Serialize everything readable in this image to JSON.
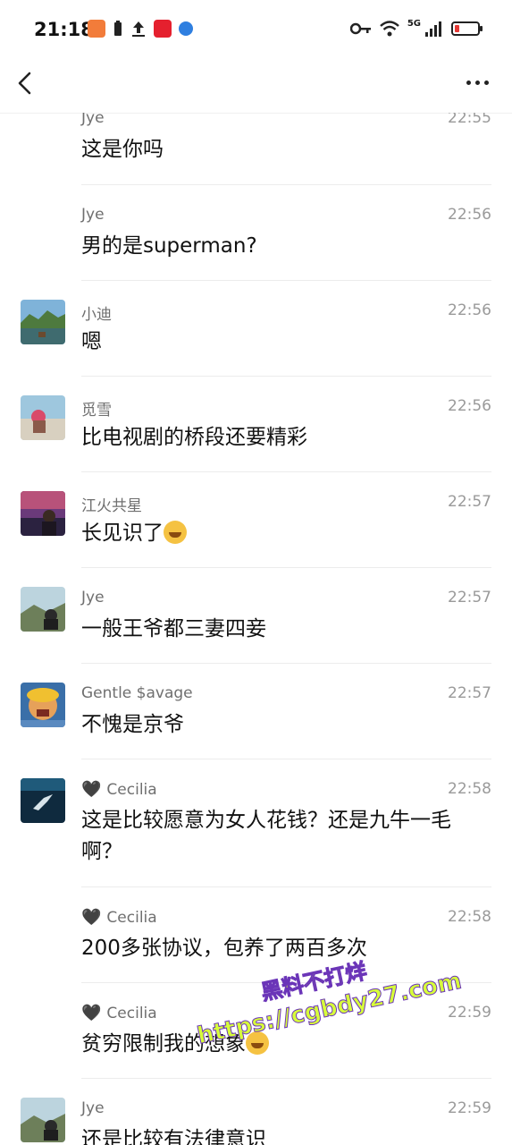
{
  "status_bar": {
    "time": "21:18",
    "network": "5G",
    "icons_left": [
      "shield-app-icon",
      "battery-saver-icon",
      "upload-icon",
      "app-red-icon",
      "app-blue-icon"
    ],
    "icons_right": [
      "key-icon",
      "wifi-icon",
      "signal-icon",
      "battery-icon"
    ],
    "battery_level": 0.1
  },
  "nav": {
    "back_icon": "chevron-left-icon",
    "more_icon": "more-dots-icon"
  },
  "messages": [
    {
      "sender": "Jye",
      "time": "22:55",
      "text": "这是你吗",
      "avatar": false
    },
    {
      "sender": "Jye",
      "time": "22:56",
      "text": "男的是superman?",
      "avatar": false
    },
    {
      "sender": "小迪",
      "time": "22:56",
      "text": "嗯",
      "avatar": true
    },
    {
      "sender": "觅雪",
      "time": "22:56",
      "text": "比电视剧的桥段还要精彩",
      "avatar": true
    },
    {
      "sender": "江火共星",
      "time": "22:57",
      "text": "长见识了",
      "avatar": true,
      "emoji": "crying-laughing-emoji"
    },
    {
      "sender": "Jye",
      "time": "22:57",
      "text": "一般王爷都三妻四妾",
      "avatar": true
    },
    {
      "sender": "Gentle $avage",
      "time": "22:57",
      "text": "不愧是京爷",
      "avatar": true
    },
    {
      "sender": "Cecilia",
      "time": "22:58",
      "text": "这是比较愿意为女人花钱？还是九牛一毛啊？",
      "avatar": true,
      "heart": "🖤"
    },
    {
      "sender": "Cecilia",
      "time": "22:58",
      "text": "200多张协议，包养了两百多次",
      "avatar": false,
      "heart": "🖤"
    },
    {
      "sender": "Cecilia",
      "time": "22:59",
      "text": "贫穷限制我的想象",
      "avatar": false,
      "heart": "🖤",
      "emoji": "crying-laughing-emoji"
    },
    {
      "sender": "Jye",
      "time": "22:59",
      "text": "还是比较有法律意识",
      "avatar": true
    }
  ],
  "watermark": {
    "line1": "黑料不打烊",
    "line2": "https://cgbdy27.com"
  },
  "colors": {
    "background": "#ffffff",
    "sender": "#6f6f6f",
    "time": "#9a9a9a",
    "divider": "#ececec",
    "watermark_fill": "#d7ff3a",
    "watermark_stroke": "#6b35b8"
  }
}
